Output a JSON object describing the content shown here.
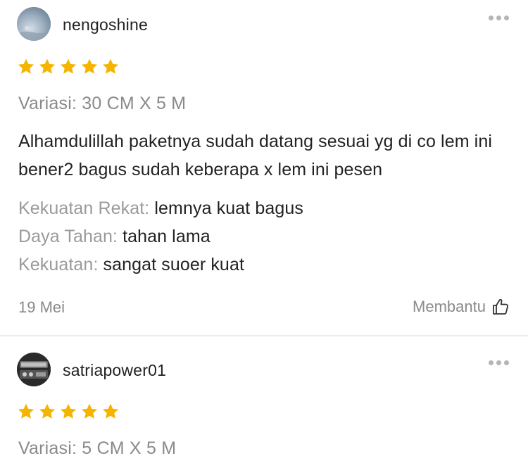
{
  "reviews": [
    {
      "username": "nengoshine",
      "avatar_icon": "sky-avatar",
      "rating": 5,
      "rating_max": 5,
      "variation": "Variasi: 30 CM X 5 M",
      "comment": "Alhamdulillah paketnya sudah datang sesuai yg di co lem ini bener2 bagus sudah keberapa x lem ini pesen",
      "attributes": [
        {
          "key": "Kekuatan Rekat:",
          "value": "lemnya kuat bagus"
        },
        {
          "key": "Daya Tahan:",
          "value": "tahan lama"
        },
        {
          "key": "Kekuatan:",
          "value": "sangat suoer kuat"
        }
      ],
      "date": "19 Mei",
      "helpful_label": "Membantu",
      "helpful_icon": "thumbs-up-icon"
    },
    {
      "username": "satriapower01",
      "avatar_icon": "device-avatar",
      "rating": 5,
      "rating_max": 5,
      "variation": "Variasi: 5 CM X 5 M"
    }
  ],
  "colors": {
    "star": "#f5b400",
    "muted_text": "#8a8a8a",
    "primary_text": "#222222",
    "divider": "#ececec"
  },
  "icons": {
    "more": "more-dots-icon",
    "star": "star-icon",
    "helpful": "thumbs-up-icon"
  }
}
